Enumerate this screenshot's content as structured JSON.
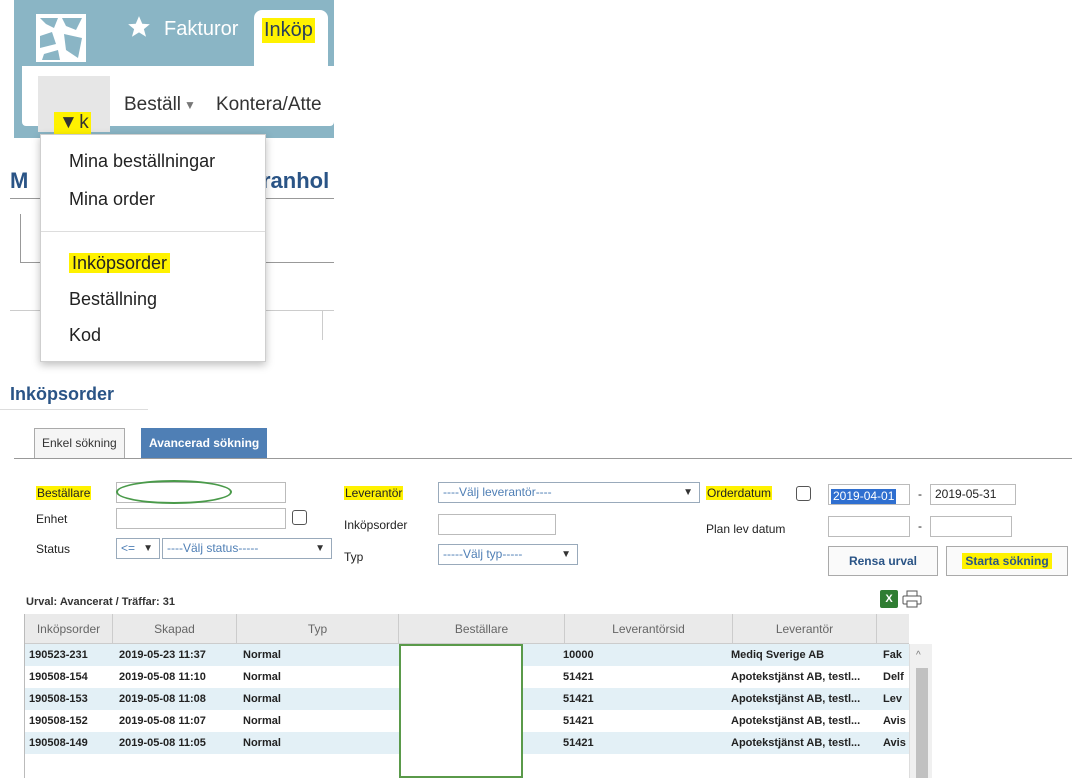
{
  "topnav": {
    "fakturor": "Fakturor",
    "inkop": "Inköp"
  },
  "subnav": {
    "sok": "Sök",
    "bestall": "Beställ",
    "kontera": "Kontera/Atte"
  },
  "background_page": {
    "title_left": "M",
    "title_right": "ranhol"
  },
  "dropdown": {
    "items": [
      "Mina beställningar",
      "Mina order",
      "Inköpsorder",
      "Beställning",
      "Kod"
    ]
  },
  "page": {
    "title": "Inköpsorder",
    "tabs": [
      "Enkel sökning",
      "Avancerad sökning"
    ]
  },
  "form": {
    "bestallare_label": "Beställare",
    "enhet_label": "Enhet",
    "status_label": "Status",
    "status_operator": "<=",
    "status_placeholder": "----Välj status-----",
    "leverantor_label": "Leverantör",
    "leverantor_placeholder": "----Välj leverantör----",
    "inkopsorder_label": "Inköpsorder",
    "typ_label": "Typ",
    "typ_placeholder": "-----Välj typ-----",
    "orderdatum_label": "Orderdatum",
    "orderdatum_from": "2019-04-01",
    "orderdatum_to": "2019-05-31",
    "orderdatum_sep": "-",
    "planlev_label": "Plan lev datum",
    "planlev_sep": "-",
    "rensa_button": "Rensa urval",
    "starta_button": "Starta sökning"
  },
  "results": {
    "summary": "Urval: Avancerat / Träffar: 31",
    "excel_icon_text": "X",
    "columns": [
      "Inköpsorder",
      "Skapad",
      "Typ",
      "Beställare",
      "Leverantörsid",
      "Leverantör"
    ],
    "rows": [
      {
        "inkopsorder": "190523-231",
        "skapad": "2019-05-23 11:37",
        "typ": "Normal",
        "leverantorsid": "10000",
        "leverantor": "Mediq Sverige AB",
        "extra": "Fak"
      },
      {
        "inkopsorder": "190508-154",
        "skapad": "2019-05-08 11:10",
        "typ": "Normal",
        "leverantorsid": "51421",
        "leverantor": "Apotekstjänst AB, testl...",
        "extra": "Delf"
      },
      {
        "inkopsorder": "190508-153",
        "skapad": "2019-05-08 11:08",
        "typ": "Normal",
        "leverantorsid": "51421",
        "leverantor": "Apotekstjänst AB, testl...",
        "extra": "Lev"
      },
      {
        "inkopsorder": "190508-152",
        "skapad": "2019-05-08 11:07",
        "typ": "Normal",
        "leverantorsid": "51421",
        "leverantor": "Apotekstjänst AB, testl...",
        "extra": "Avis"
      },
      {
        "inkopsorder": "190508-149",
        "skapad": "2019-05-08 11:05",
        "typ": "Normal",
        "leverantorsid": "51421",
        "leverantor": "Apotekstjänst AB, testl...",
        "extra": "Avis"
      }
    ]
  },
  "icons": {
    "logo": "app-logo",
    "favorites": "star-icon",
    "excel": "excel-icon",
    "print": "print-icon",
    "dropdown_caret": "chevron-down-icon"
  },
  "colors": {
    "topbar": "#8ab5c5",
    "highlight": "#fff200",
    "title_blue": "#2a5486",
    "tab_active": "#4f7fb5",
    "row_alt": "#e3f0f6",
    "annotation_green": "#4a9a4a"
  }
}
